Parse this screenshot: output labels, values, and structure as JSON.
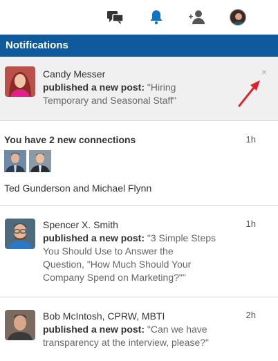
{
  "topnav": {
    "icons": [
      "messages-icon",
      "notifications-bell-icon",
      "add-connection-icon",
      "profile-avatar"
    ]
  },
  "header": {
    "title": "Notifications"
  },
  "notifications": [
    {
      "name": "Candy Messer",
      "action": "published a new post:",
      "post_line1": "\"Hiring",
      "post_line2": "Temporary and Seasonal Staff\"",
      "time": "",
      "close": "×"
    },
    {
      "title": "You have 2 new connections",
      "time": "1h",
      "names": "Ted Gunderson and Michael Flynn"
    },
    {
      "name": "Spencer X. Smith",
      "action": "published a new post:",
      "post_line1": "\"3 Simple Steps",
      "post_line2": "You Should Use to Answer the",
      "post_line3": "Question, \"How Much Should Your",
      "post_line4": "Company Spend on Marketing?\"\"",
      "time": "1h"
    },
    {
      "name": "Bob McIntosh, CPRW, MBTI",
      "action": "published a new post:",
      "post_line1": "\"Can we have",
      "post_line2": "transparency at the interview, please?\"",
      "time": "2h"
    }
  ],
  "colors": {
    "header_bg": "#0e5a9c",
    "highlight_bg": "#f0f0f0",
    "accent": "#0e5a9c",
    "arrow": "#e0202a"
  }
}
